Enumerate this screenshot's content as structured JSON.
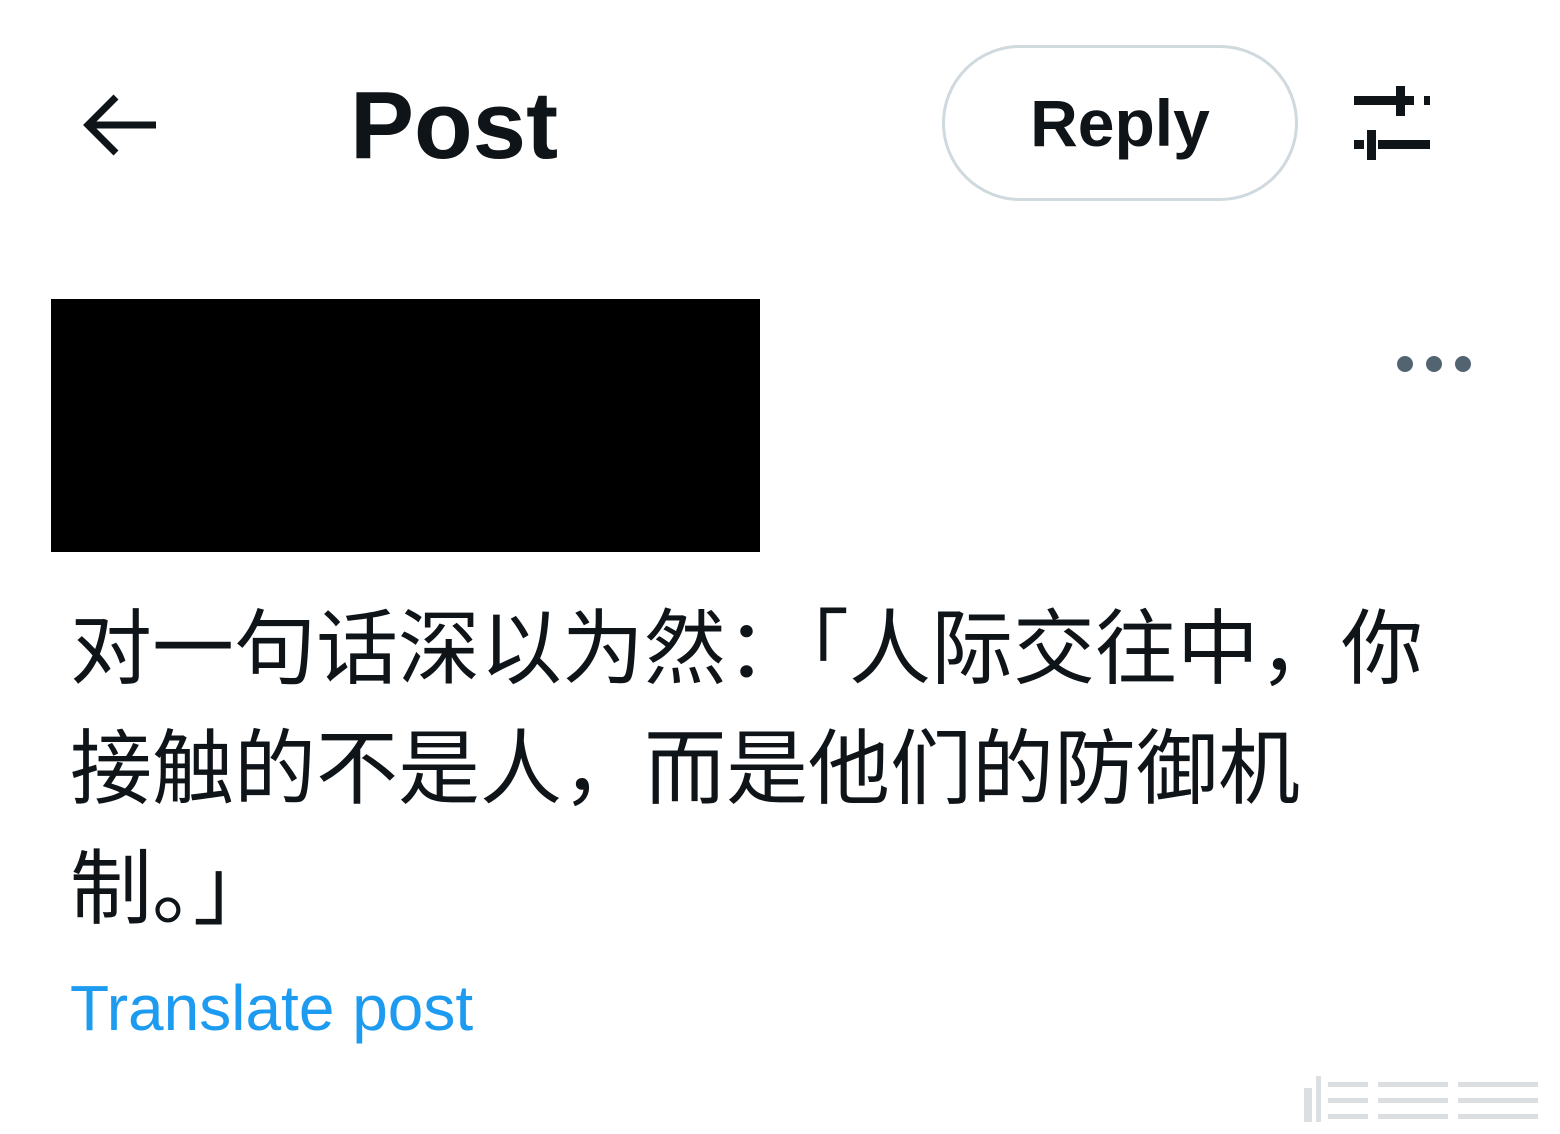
{
  "header": {
    "title": "Post",
    "reply_label": "Reply",
    "back_icon": "arrow-left-icon",
    "settings_icon": "sliders-icon"
  },
  "post": {
    "more_icon": "more-horizontal-icon",
    "text": "对一句话深以为然：「人际交往中，你接触的不是人，而是他们的防御机制。」",
    "translate_label": "Translate post"
  },
  "colors": {
    "text": "#0f1419",
    "link": "#1d9bf0",
    "border": "#cfd9de",
    "icon_secondary": "#536471"
  }
}
